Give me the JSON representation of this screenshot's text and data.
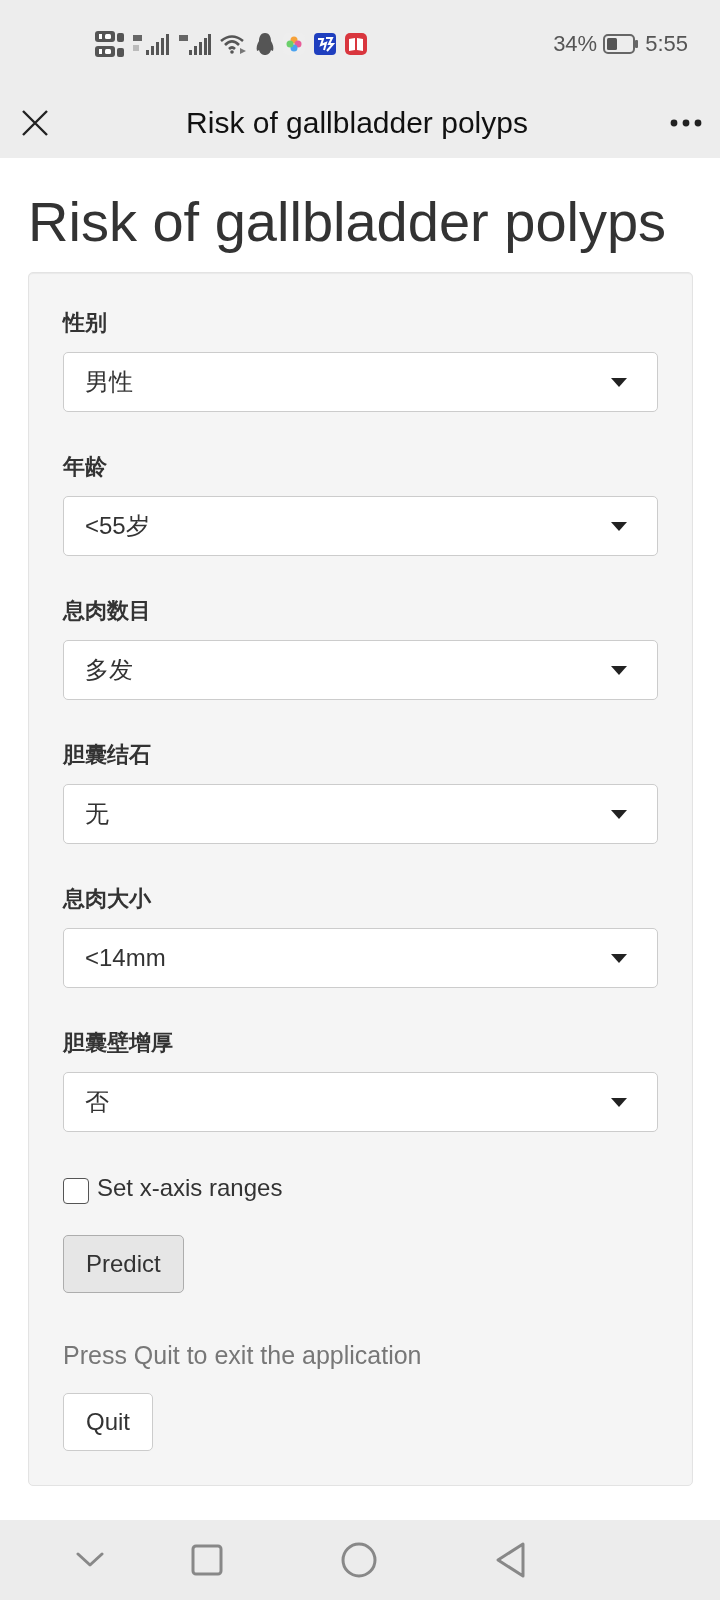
{
  "status_bar": {
    "battery_text": "34%",
    "time": "5:55"
  },
  "title_bar": {
    "title": "Risk of gallbladder polyps"
  },
  "heading": "Risk of gallbladder polyps",
  "form": {
    "fields": [
      {
        "label": "性别",
        "value": "男性"
      },
      {
        "label": "年龄",
        "value": "<55岁"
      },
      {
        "label": "息肉数目",
        "value": "多发"
      },
      {
        "label": "胆囊结石",
        "value": "无"
      },
      {
        "label": "息肉大小",
        "value": "<14mm"
      },
      {
        "label": "胆囊壁增厚",
        "value": "否"
      }
    ],
    "checkbox": {
      "label": "Set x-axis ranges",
      "checked": false
    },
    "predict_button": "Predict",
    "hint": "Press Quit to exit the application",
    "quit_button": "Quit"
  }
}
